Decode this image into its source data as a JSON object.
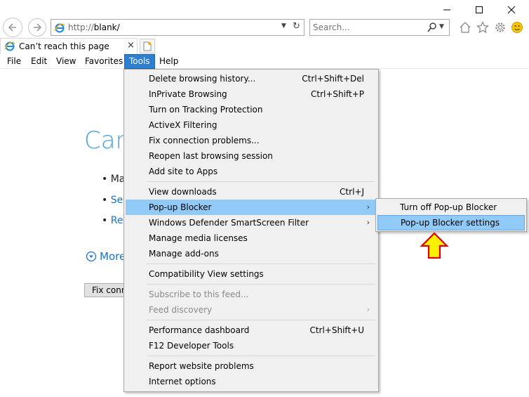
{
  "window": {
    "controls": [
      "minimize-icon",
      "maximize-icon",
      "close-icon"
    ]
  },
  "address_bar": {
    "url_proto": "http://",
    "url_host": "blank/",
    "favicon": "ie-icon"
  },
  "search": {
    "placeholder": "Search...",
    "icon": "search-icon"
  },
  "toolbar_icons": [
    "home-icon",
    "favorites-star-icon",
    "gear-icon",
    "smiley-feedback-icon"
  ],
  "tab": {
    "title": "Can’t reach this page",
    "close": "×"
  },
  "menubar": {
    "items": [
      "File",
      "Edit",
      "View",
      "Favorites",
      "Tools",
      "Help"
    ],
    "active": "Tools"
  },
  "page": {
    "title_visible": "Can",
    "bullet1": "Ma",
    "bullet2": "Se",
    "bullet3": "Re",
    "more": "More",
    "fix_button": "Fix conn"
  },
  "tools_menu": {
    "items": [
      {
        "label": "Delete browsing history...",
        "shortcut": "Ctrl+Shift+Del"
      },
      {
        "label": "InPrivate Browsing",
        "shortcut": "Ctrl+Shift+P"
      },
      {
        "label": "Turn on Tracking Protection",
        "shortcut": ""
      },
      {
        "label": "ActiveX Filtering",
        "shortcut": ""
      },
      {
        "label": "Fix connection problems...",
        "shortcut": ""
      },
      {
        "label": "Reopen last browsing session",
        "shortcut": ""
      },
      {
        "label": "Add site to Apps",
        "shortcut": ""
      },
      {
        "label": "View downloads",
        "shortcut": "Ctrl+J"
      },
      {
        "label": "Pop-up Blocker",
        "shortcut": ""
      },
      {
        "label": "Windows Defender SmartScreen Filter",
        "shortcut": ""
      },
      {
        "label": "Manage media licenses",
        "shortcut": ""
      },
      {
        "label": "Manage add-ons",
        "shortcut": ""
      },
      {
        "label": "Compatibility View settings",
        "shortcut": ""
      },
      {
        "label": "Subscribe to this feed...",
        "shortcut": ""
      },
      {
        "label": "Feed discovery",
        "shortcut": ""
      },
      {
        "label": "Performance dashboard",
        "shortcut": "Ctrl+Shift+U"
      },
      {
        "label": "F12 Developer Tools",
        "shortcut": ""
      },
      {
        "label": "Report website problems",
        "shortcut": ""
      },
      {
        "label": "Internet options",
        "shortcut": ""
      }
    ]
  },
  "popup_submenu": {
    "items": [
      {
        "label": "Turn off Pop-up Blocker"
      },
      {
        "label": "Pop-up Blocker settings"
      }
    ],
    "highlighted": "Pop-up Blocker settings"
  },
  "colors": {
    "highlight": "#91c9f7",
    "menu_bg": "#f0f0f0",
    "active_menu": "#2e7fd2",
    "link": "#1a73c8",
    "title": "#4aa4e0",
    "arrow_fill": "#ffef00",
    "arrow_stroke": "#e00000"
  }
}
